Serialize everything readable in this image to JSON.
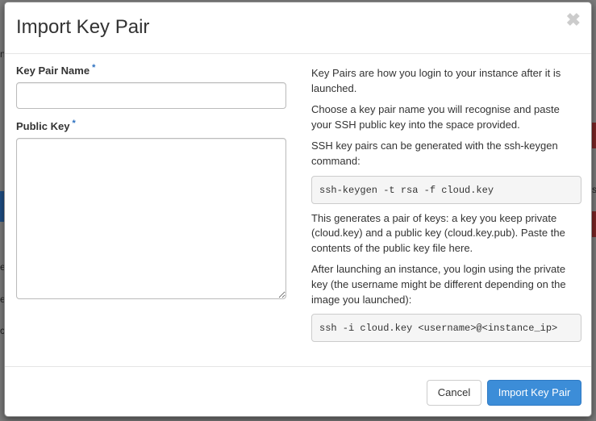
{
  "modal": {
    "title": "Import Key Pair",
    "close_symbol": "✖"
  },
  "form": {
    "key_pair_name": {
      "label": "Key Pair Name",
      "required_marker": "*",
      "value": ""
    },
    "public_key": {
      "label": "Public Key",
      "required_marker": "*",
      "value": ""
    }
  },
  "help": {
    "p1": "Key Pairs are how you login to your instance after it is launched.",
    "p2": "Choose a key pair name you will recognise and paste your SSH public key into the space provided.",
    "p3": "SSH key pairs can be generated with the ssh-keygen command:",
    "code1": "ssh-keygen -t rsa -f cloud.key",
    "p4": "This generates a pair of keys: a key you keep private (cloud.key) and a public key (cloud.key.pub). Paste the contents of the public key file here.",
    "p5": "After launching an instance, you login using the private key (the username might be different depending on the image you launched):",
    "code2": "ssh -i cloud.key <username>@<instance_ip>"
  },
  "footer": {
    "cancel_label": "Cancel",
    "submit_label": "Import Key Pair"
  },
  "background": {
    "frag1": "n",
    "frag2": "et",
    "frag3": "e",
    "frag4": "c",
    "frag5": "s"
  },
  "colors": {
    "primary": "#3c8dd8",
    "required": "#2a6fbf"
  }
}
